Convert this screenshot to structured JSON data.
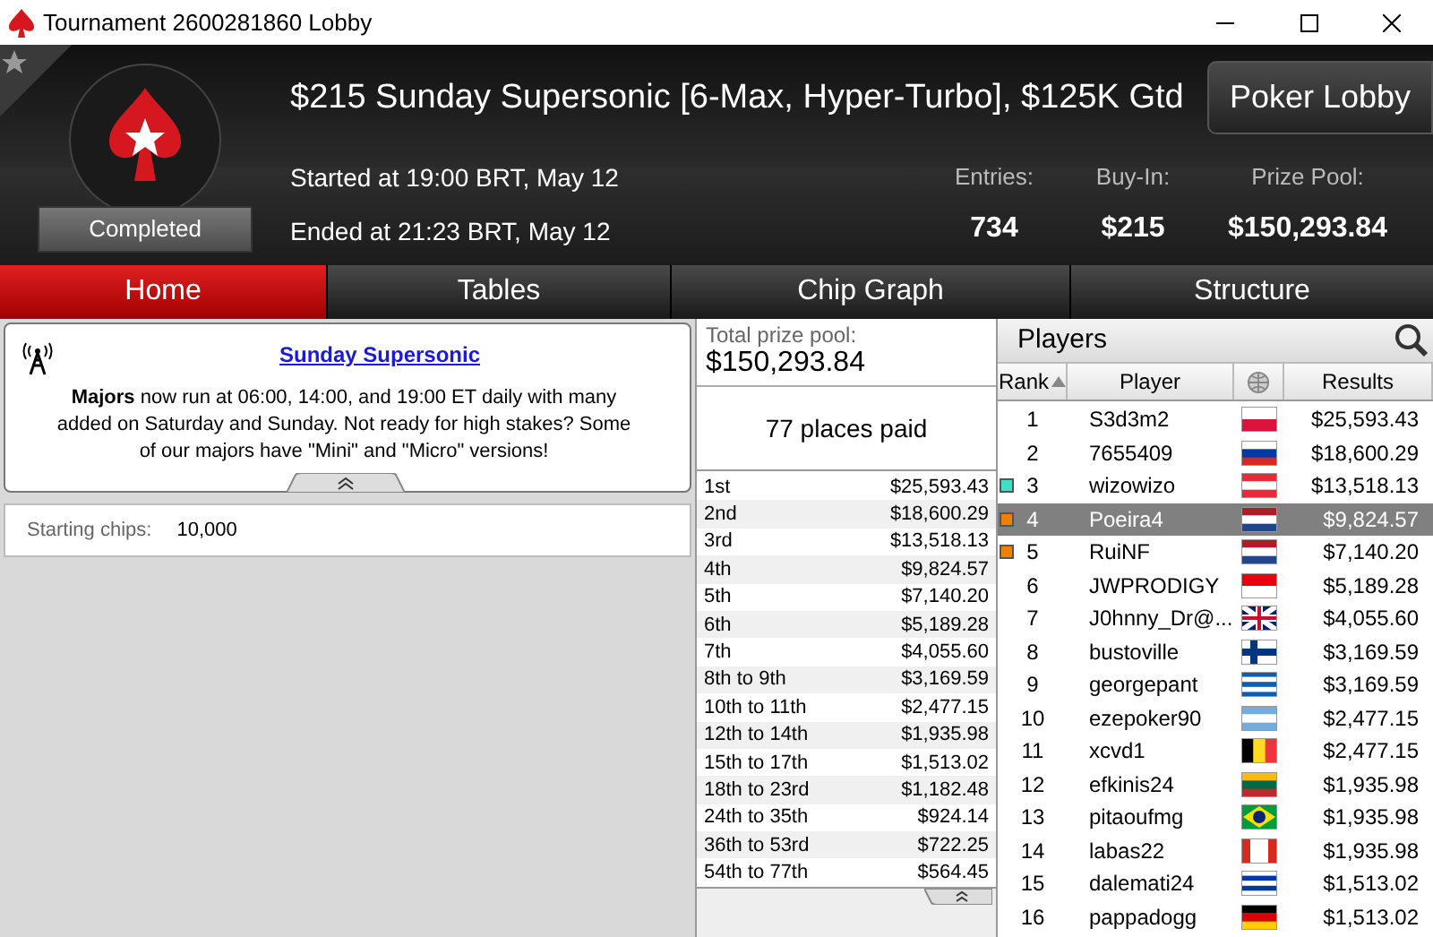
{
  "window": {
    "title": "Tournament 2600281860 Lobby"
  },
  "header": {
    "title": "$215 Sunday Supersonic [6-Max, Hyper-Turbo], $125K Gtd",
    "status": "Completed",
    "started": "Started at 19:00 BRT, May 12",
    "ended": "Ended at 21:23 BRT, May 12",
    "lobby_button": "Poker Lobby",
    "stats": [
      {
        "label": "Entries:",
        "value": "734"
      },
      {
        "label": "Buy-In:",
        "value": "$215"
      },
      {
        "label": "Prize Pool:",
        "value": "$150,293.84"
      }
    ]
  },
  "tabs": [
    {
      "label": "Home",
      "selected": true
    },
    {
      "label": "Tables",
      "selected": false
    },
    {
      "label": "Chip Graph",
      "selected": false
    },
    {
      "label": "Structure",
      "selected": false
    }
  ],
  "news": {
    "title": "Sunday Supersonic",
    "body": "**Majors** now run at 06:00, 14:00, and 19:00 ET daily with many added on Saturday and Sunday. Not ready for high stakes? Some of our majors have \"Mini\" and \"Micro\" versions!"
  },
  "starting_chips": {
    "label": "Starting chips:",
    "value": "10,000"
  },
  "prizes": {
    "total_label": "Total prize pool:",
    "total_value": "$150,293.84",
    "places_paid": "77 places paid",
    "payouts": [
      {
        "place": "1st",
        "amount": "$25,593.43"
      },
      {
        "place": "2nd",
        "amount": "$18,600.29"
      },
      {
        "place": "3rd",
        "amount": "$13,518.13"
      },
      {
        "place": "4th",
        "amount": "$9,824.57"
      },
      {
        "place": "5th",
        "amount": "$7,140.20"
      },
      {
        "place": "6th",
        "amount": "$5,189.28"
      },
      {
        "place": "7th",
        "amount": "$4,055.60"
      },
      {
        "place": "8th to 9th",
        "amount": "$3,169.59"
      },
      {
        "place": "10th to 11th",
        "amount": "$2,477.15"
      },
      {
        "place": "12th to 14th",
        "amount": "$1,935.98"
      },
      {
        "place": "15th to 17th",
        "amount": "$1,513.02"
      },
      {
        "place": "18th to 23rd",
        "amount": "$1,182.48"
      },
      {
        "place": "24th to 35th",
        "amount": "$924.14"
      },
      {
        "place": "36th to 53rd",
        "amount": "$722.25"
      },
      {
        "place": "54th to 77th",
        "amount": "$564.45"
      }
    ]
  },
  "players": {
    "title": "Players",
    "columns": [
      {
        "label": "Rank",
        "sorted": true
      },
      {
        "label": "Player",
        "sorted": false
      },
      {
        "label": "Results",
        "sorted": false
      }
    ],
    "rows": [
      {
        "rank": "1",
        "name": "S3d3m2",
        "result": "$25,593.43",
        "selected": false,
        "flag": {
          "kind": "poland"
        }
      },
      {
        "rank": "2",
        "name": "7655409",
        "result": "$18,600.29",
        "selected": false,
        "flag": {
          "kind": "russia"
        }
      },
      {
        "rank": "3",
        "name": "wizowizo",
        "result": "$13,518.13",
        "selected": false,
        "color": "#40e0c8",
        "flag": {
          "kind": "austria"
        }
      },
      {
        "rank": "4",
        "name": "Poeira4",
        "result": "$9,824.57",
        "selected": true,
        "color": "#f08000",
        "flag": {
          "kind": "netherlands"
        }
      },
      {
        "rank": "5",
        "name": "RuiNF",
        "result": "$7,140.20",
        "selected": false,
        "color": "#f08000",
        "flag": {
          "kind": "netherlands"
        }
      },
      {
        "rank": "6",
        "name": "JWPRODIGY",
        "result": "$5,189.28",
        "selected": false,
        "flag": {
          "kind": "indonesia"
        }
      },
      {
        "rank": "7",
        "name": "J0hnny_Dr@...",
        "result": "$4,055.60",
        "selected": false,
        "flag": {
          "kind": "uk"
        }
      },
      {
        "rank": "8",
        "name": "bustoville",
        "result": "$3,169.59",
        "selected": false,
        "flag": {
          "kind": "finland"
        }
      },
      {
        "rank": "9",
        "name": "georgepant",
        "result": "$3,169.59",
        "selected": false,
        "flag": {
          "kind": "greece"
        }
      },
      {
        "rank": "10",
        "name": "ezepoker90",
        "result": "$2,477.15",
        "selected": false,
        "flag": {
          "kind": "argentina"
        }
      },
      {
        "rank": "11",
        "name": "xcvd1",
        "result": "$2,477.15",
        "selected": false,
        "flag": {
          "kind": "belgium"
        }
      },
      {
        "rank": "12",
        "name": "efkinis24",
        "result": "$1,935.98",
        "selected": false,
        "flag": {
          "kind": "lithuania"
        }
      },
      {
        "rank": "13",
        "name": "pitaoufmg",
        "result": "$1,935.98",
        "selected": false,
        "flag": {
          "kind": "brazil"
        }
      },
      {
        "rank": "14",
        "name": "labas22",
        "result": "$1,935.98",
        "selected": false,
        "flag": {
          "kind": "canada"
        }
      },
      {
        "rank": "15",
        "name": "dalemati24",
        "result": "$1,513.02",
        "selected": false,
        "flag": {
          "kind": "uruguay"
        }
      },
      {
        "rank": "16",
        "name": "pappadogg",
        "result": "$1,513.02",
        "selected": false,
        "flag": {
          "kind": "germany"
        }
      }
    ]
  }
}
